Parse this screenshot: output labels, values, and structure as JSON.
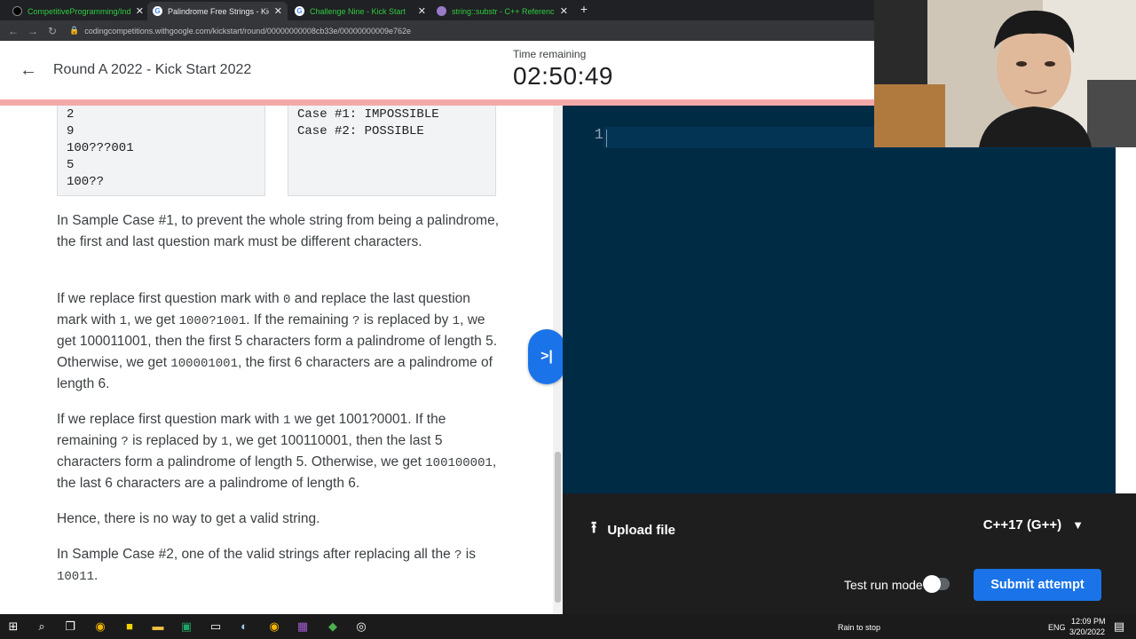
{
  "browser": {
    "tabs": [
      {
        "title": "CompetitiveProgramming/Index.",
        "active": false
      },
      {
        "title": "Palindrome Free Strings - Kick St",
        "active": true
      },
      {
        "title": "Challenge Nine - Kick Start",
        "active": false
      },
      {
        "title": "string::substr - C++ Reference",
        "active": false
      }
    ],
    "url": "codingcompetitions.withgoogle.com/kickstart/round/00000000008cb33e/00000000009e762e"
  },
  "header": {
    "title": "Round A 2022 - Kick Start 2022",
    "time_remaining_label": "Time remaining",
    "time_remaining_value": "02:50:49"
  },
  "samples": {
    "input": "2\n9\n100???001\n5\n100??",
    "output": "Case #1: IMPOSSIBLE\nCase #2: POSSIBLE"
  },
  "explanation": {
    "p1": "In Sample Case #1, to prevent the whole string from being a palindrome, the first and last question mark must be different characters.",
    "p2": {
      "t1": "If we replace first question mark with ",
      "c1": "0",
      "t2": " and replace the last question mark with ",
      "c2": "1",
      "t3": ", we get ",
      "c3": "1000?1001",
      "t4": ". If the remaining ",
      "c4": "?",
      "t5": " is replaced by ",
      "c5": "1",
      "t6": ", we get 100011001, then the first 5 characters form a palindrome of length 5. Otherwise, we get ",
      "c6": "100001001",
      "t7": ", the first 6 characters are a palindrome of length 6."
    },
    "p3": {
      "t1": "If we replace first question mark with ",
      "c1": "1",
      "t2": " we get 1001?0001. If the remaining ",
      "c2": "?",
      "t3": " is replaced by ",
      "c3": "1",
      "t4": ", we get 100110001, then the last 5 characters form a palindrome of length 5. Otherwise, we get ",
      "c4": "100100001",
      "t5": ", the last 6 characters are a palindrome of length 6."
    },
    "p4": "Hence, there is no way to get a valid string.",
    "p5": {
      "t1": "In Sample Case #2, one of the valid strings after replacing all the ",
      "c1": "?",
      "t2": " is ",
      "c2": "10011",
      "t3": "."
    }
  },
  "editor": {
    "line_number": "1",
    "upload_label": "Upload file",
    "language": "C++17 (G++)",
    "test_run_label": "Test run mode",
    "submit_label": "Submit attempt"
  },
  "taskbar": {
    "weather": "Rain to stop",
    "lang": "ENG",
    "time": "12:09 PM",
    "date": "3/20/2022"
  },
  "colors": {
    "accent": "#1a73e8",
    "editor_bg": "#002b45",
    "timebar": "#f4a9a9"
  }
}
